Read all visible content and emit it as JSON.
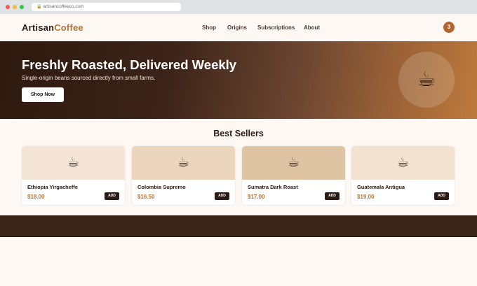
{
  "browser": {
    "url": "artisancoffeeco.com"
  },
  "header": {
    "logo_part1": "Artisan",
    "logo_part2": "Coffee",
    "nav": [
      "Shop",
      "Origins",
      "Subscriptions",
      "About"
    ],
    "cart_count": "3"
  },
  "hero": {
    "title": "Freshly Roasted, Delivered Weekly",
    "subtitle": "Single-origin beans sourced directly from small farms.",
    "cta_label": "Shop Now",
    "icon": "coffee-cup-icon"
  },
  "products": {
    "title": "Best Sellers",
    "items": [
      {
        "name": "Ethiopia Yirgacheffe",
        "price": "$18.00",
        "add_label": "ADD",
        "bg": "#f5e5d6"
      },
      {
        "name": "Colombia Supremo",
        "price": "$16.50",
        "add_label": "ADD",
        "bg": "#ebd5bd"
      },
      {
        "name": "Sumatra Dark Roast",
        "price": "$17.00",
        "add_label": "ADD",
        "bg": "#dec4a3"
      },
      {
        "name": "Guatemala Antigua",
        "price": "$19.00",
        "add_label": "ADD",
        "bg": "#f4e2d1"
      }
    ]
  },
  "colors": {
    "accent": "#b87333",
    "dark": "#2b1b14",
    "cart_badge": "#b5652b",
    "footer": "#3a2418"
  }
}
